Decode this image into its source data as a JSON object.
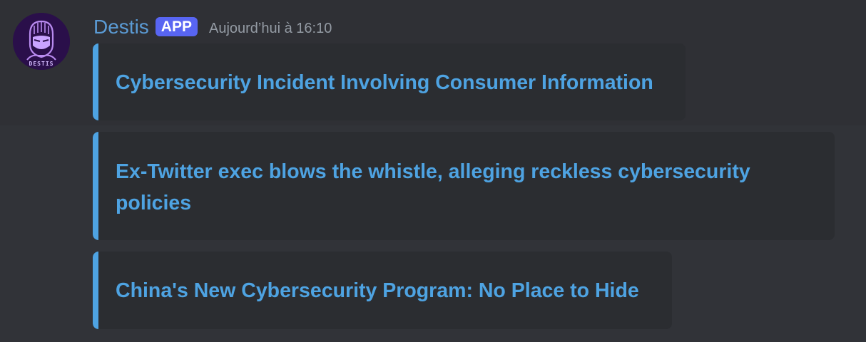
{
  "message": {
    "avatar_text": "DESTIS",
    "author": "Destis",
    "badge": "APP",
    "timestamp": "Aujourd’hui à 16:10"
  },
  "embeds": [
    {
      "title": "Cybersecurity Incident Involving Consumer Information"
    },
    {
      "title": "Ex-Twitter exec blows the whistle, alleging reckless cybersecurity policies"
    },
    {
      "title": "China's New Cybersecurity Program: No Place to Hide"
    }
  ],
  "colors": {
    "background": "#313338",
    "embed_background": "#2b2d31",
    "embed_accent": "#4ea3e2",
    "author": "#5b9bd5",
    "badge": "#5865f2",
    "timestamp": "#949ba4"
  }
}
